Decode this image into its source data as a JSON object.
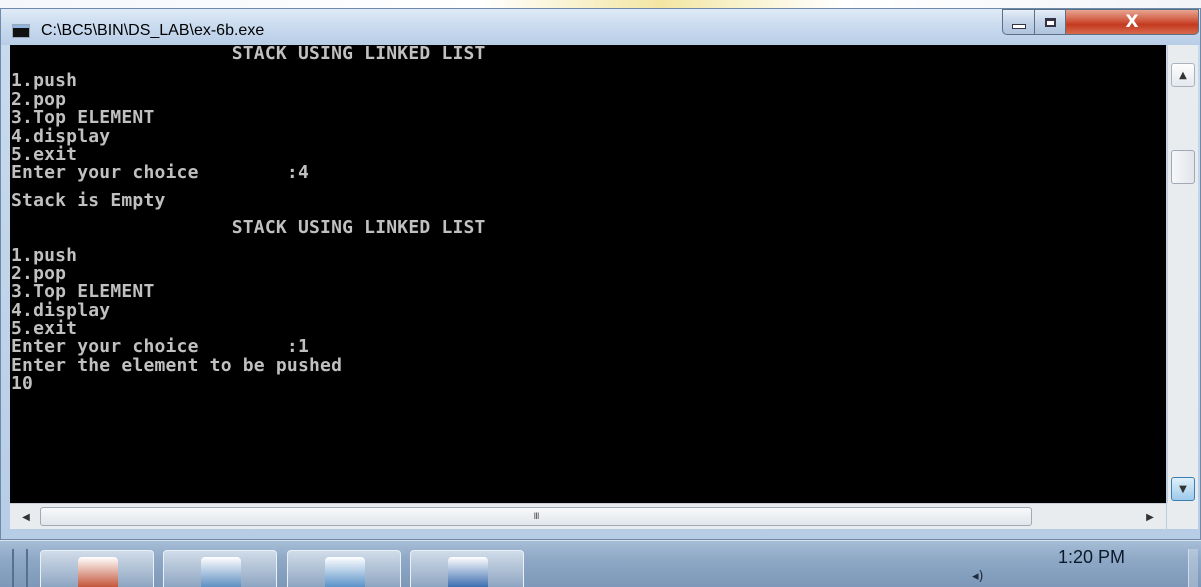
{
  "window": {
    "title": "C:\\BC5\\BIN\\DS_LAB\\ex-6b.exe",
    "close_glyph": "X"
  },
  "console": {
    "lines": [
      "                    STACK USING LINKED LIST",
      "",
      "1.push",
      "2.pop",
      "3.Top ELEMENT",
      "4.display",
      "5.exit",
      "Enter your choice        :4",
      "",
      "Stack is Empty",
      "",
      "                    STACK USING LINKED LIST",
      "",
      "1.push",
      "2.pop",
      "3.Top ELEMENT",
      "4.display",
      "5.exit",
      "Enter your choice        :1",
      "Enter the element to be pushed",
      "10"
    ]
  },
  "scrollbar": {
    "up_arrow": "▲",
    "down_arrow": "▼",
    "left_arrow": "◀",
    "right_arrow": "▶",
    "thumb_grip": "III"
  },
  "taskbar": {
    "clock": "1:20 PM",
    "apps": [
      {
        "icon": "explorer-icon",
        "color": "#c4573b"
      },
      {
        "icon": "notepad-icon",
        "color": "#5f8fc2"
      },
      {
        "icon": "paint-icon",
        "color": "#5c93c9"
      },
      {
        "icon": "console-icon",
        "color": "#3d6fb0"
      }
    ]
  }
}
